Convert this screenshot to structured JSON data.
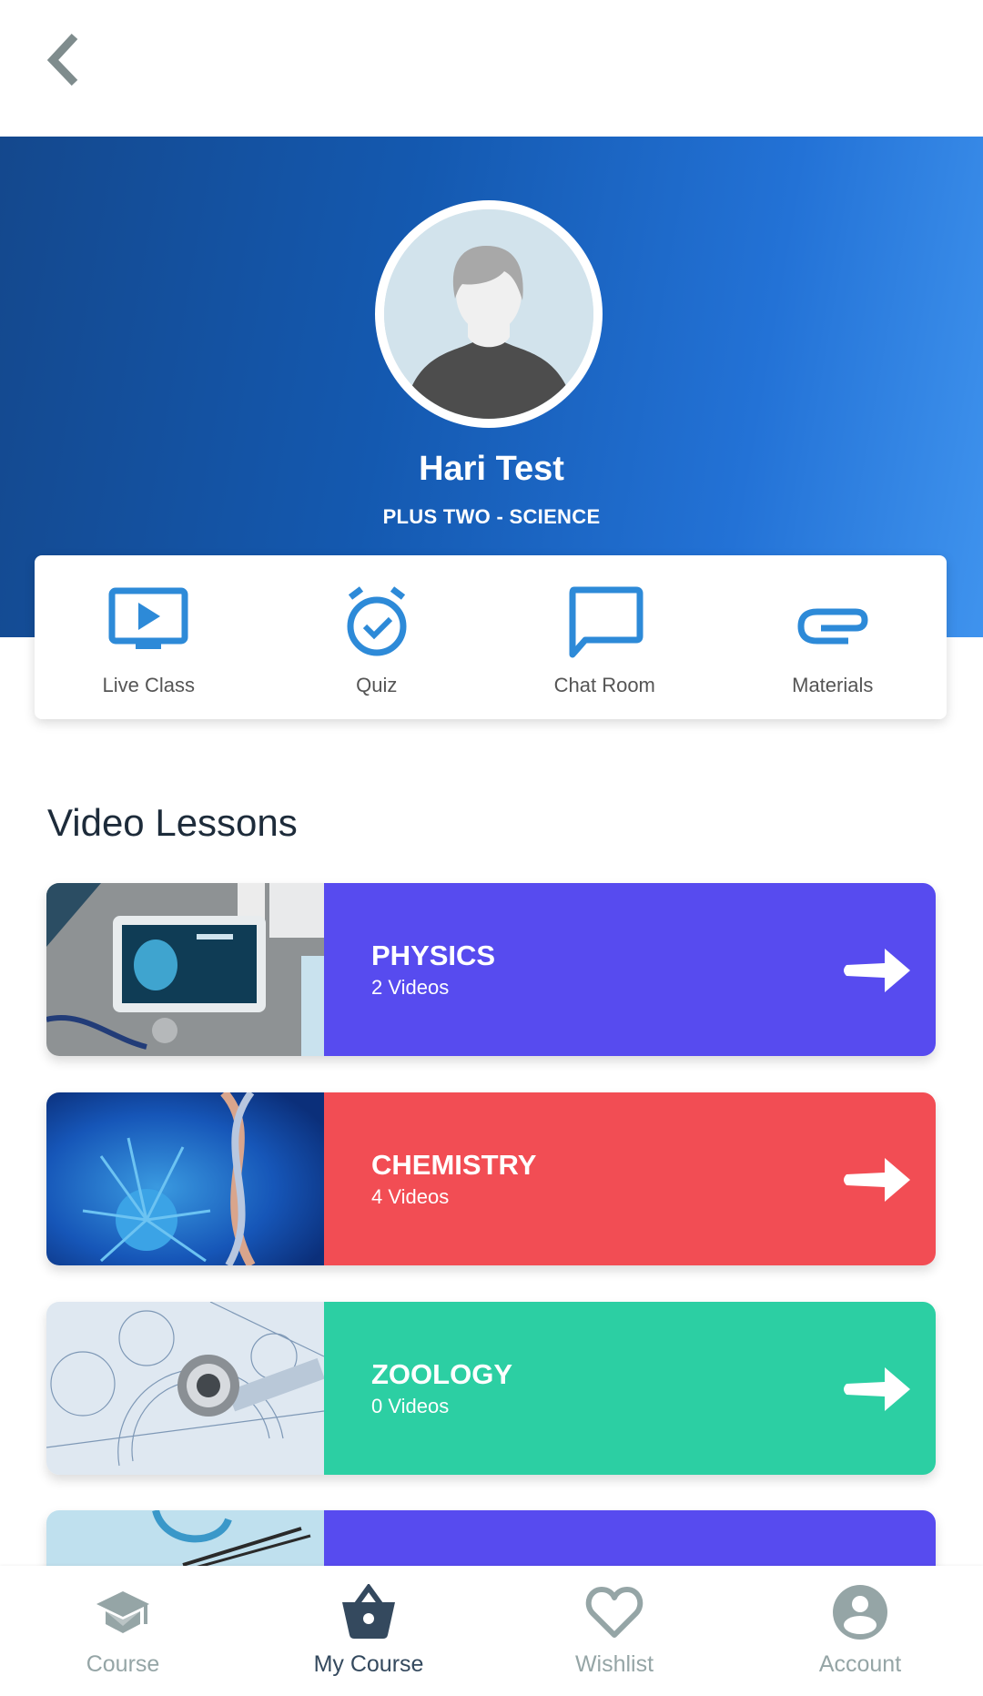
{
  "header": {
    "back_icon": "chevron-left-icon"
  },
  "profile": {
    "name": "Hari Test",
    "class": "PLUS TWO - SCIENCE",
    "avatar_icon": "default-user-avatar"
  },
  "quick_actions": [
    {
      "label": "Live Class",
      "icon": "tv-play-icon"
    },
    {
      "label": "Quiz",
      "icon": "alarm-check-icon"
    },
    {
      "label": "Chat Room",
      "icon": "chat-bubble-icon"
    },
    {
      "label": "Materials",
      "icon": "paperclip-icon"
    }
  ],
  "lessons_section": {
    "title": "Video Lessons",
    "items": [
      {
        "title": "PHYSICS",
        "count": "2 Videos",
        "color": "#574bef",
        "thumb": "medical-tablet-heart-image"
      },
      {
        "title": "CHEMISTRY",
        "count": "4 Videos",
        "color": "#f24d54",
        "thumb": "virus-dna-image"
      },
      {
        "title": "ZOOLOGY",
        "count": "0 Videos",
        "color": "#2ccfa3",
        "thumb": "engineering-bearing-image"
      },
      {
        "title": "",
        "count": "",
        "color": "#574bef",
        "thumb": "stethoscope-image"
      }
    ]
  },
  "bottom_nav": {
    "items": [
      {
        "label": "Course",
        "icon": "graduation-cap-icon",
        "active": false
      },
      {
        "label": "My Course",
        "icon": "basket-icon",
        "active": true
      },
      {
        "label": "Wishlist",
        "icon": "heart-icon",
        "active": false
      },
      {
        "label": "Account",
        "icon": "account-circle-icon",
        "active": false
      }
    ]
  },
  "colors": {
    "accent_blue": "#2d8ad8",
    "nav_inactive": "#95a5a6",
    "nav_active": "#34495e"
  }
}
